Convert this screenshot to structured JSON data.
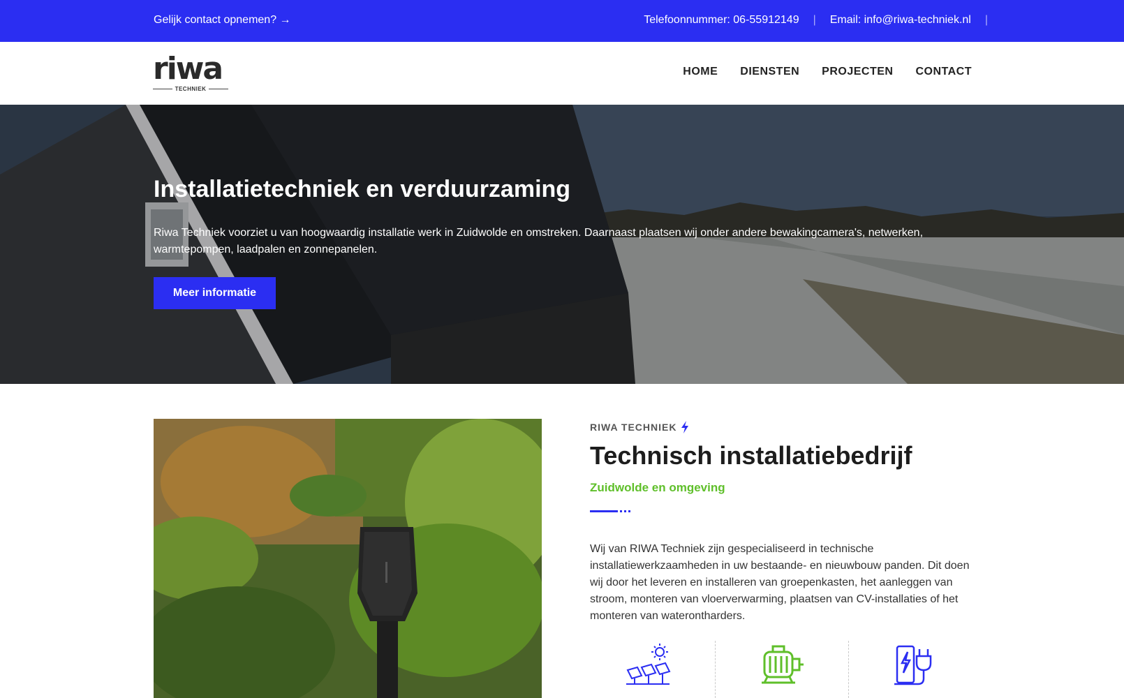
{
  "topbar": {
    "contact_cta": "Gelijk contact opnemen? →",
    "phone": "Telefoonnummer: 06-55912149",
    "email": "Email: info@riwa-techniek.nl",
    "separator": "|"
  },
  "logo": {
    "word": "riwa",
    "sub": "TECHNIEK"
  },
  "nav": {
    "items": [
      "HOME",
      "DIENSTEN",
      "PROJECTEN",
      "CONTACT"
    ]
  },
  "hero": {
    "title": "Installatietechniek en verduurzaming",
    "text": "Riwa Techniek voorziet u van hoogwaardig installatie werk in Zuidwolde en omstreken. Daarnaast plaatsen wij onder andere bewakingcamera's, netwerken, warmtepompen, laadpalen en zonnepanelen.",
    "button": "Meer informatie"
  },
  "about": {
    "kicker": "RIWA TECHNIEK",
    "title": "Technisch installatiebedrijf",
    "subtitle": "Zuidwolde en omgeving",
    "text": "Wij van RIWA Techniek zijn gespecialiseerd in technische installatiewerkzaamheden in uw bestaande- en nieuwbouw panden. Dit doen wij door het leveren en installeren van groepenkasten, het aanleggen van stroom, monteren van vloerverwarming, plaatsen van CV-installaties of het monteren van waterontharders."
  },
  "services": [
    {
      "icon": "solar-panel-icon"
    },
    {
      "icon": "electric-motor-icon"
    },
    {
      "icon": "ev-charger-icon"
    }
  ],
  "colors": {
    "brand_blue": "#2b2ef2",
    "accent_green": "#5fbf2a",
    "text_dark": "#1d1d1d"
  }
}
